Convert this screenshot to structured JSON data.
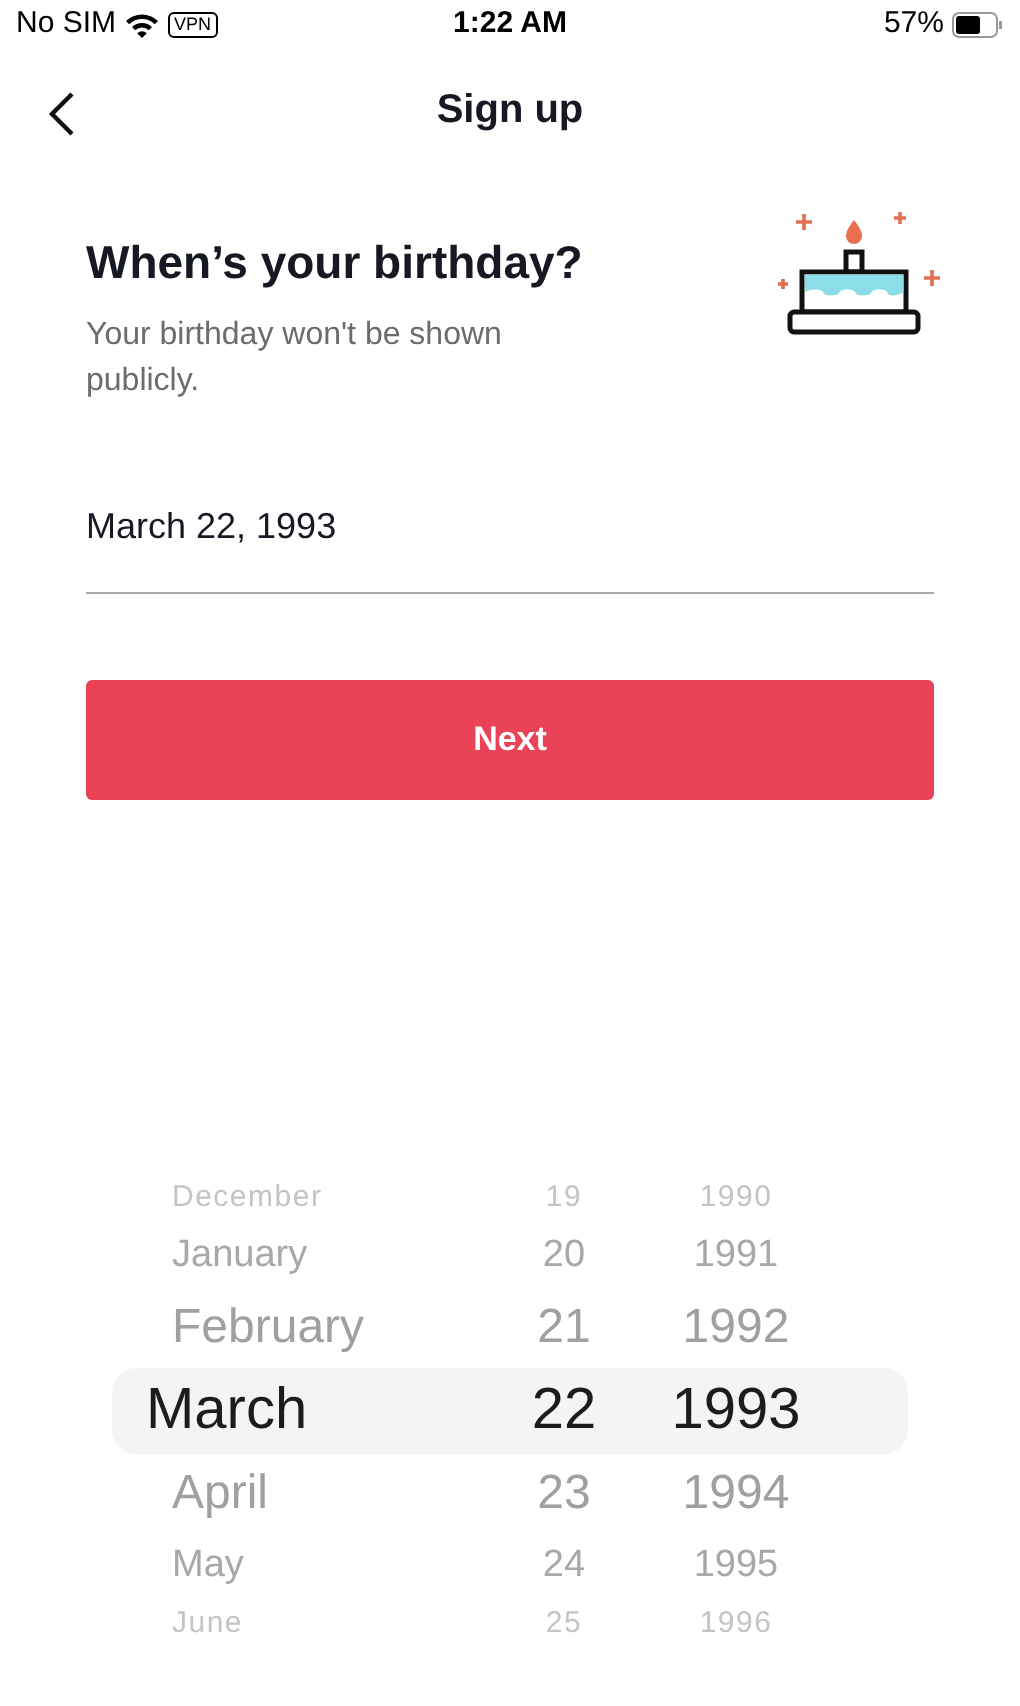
{
  "status_bar": {
    "carrier": "No SIM",
    "vpn": "VPN",
    "time": "1:22 AM",
    "battery": "57%"
  },
  "header": {
    "title": "Sign up"
  },
  "heading": "When’s your birthday?",
  "subtitle": "Your birthday won't be shown publicly.",
  "birthday_field": {
    "value": "March 22, 1993"
  },
  "next_button": "Next",
  "picker_rows": [
    {
      "month": "December",
      "day": "19",
      "year": "1990",
      "selected": false
    },
    {
      "month": "January",
      "day": "20",
      "year": "1991",
      "selected": false
    },
    {
      "month": "February",
      "day": "21",
      "year": "1992",
      "selected": false
    },
    {
      "month": "March",
      "day": "22",
      "year": "1993",
      "selected": true
    },
    {
      "month": "April",
      "day": "23",
      "year": "1994",
      "selected": false
    },
    {
      "month": "May",
      "day": "24",
      "year": "1995",
      "selected": false
    },
    {
      "month": "June",
      "day": "25",
      "year": "1996",
      "selected": false
    }
  ]
}
